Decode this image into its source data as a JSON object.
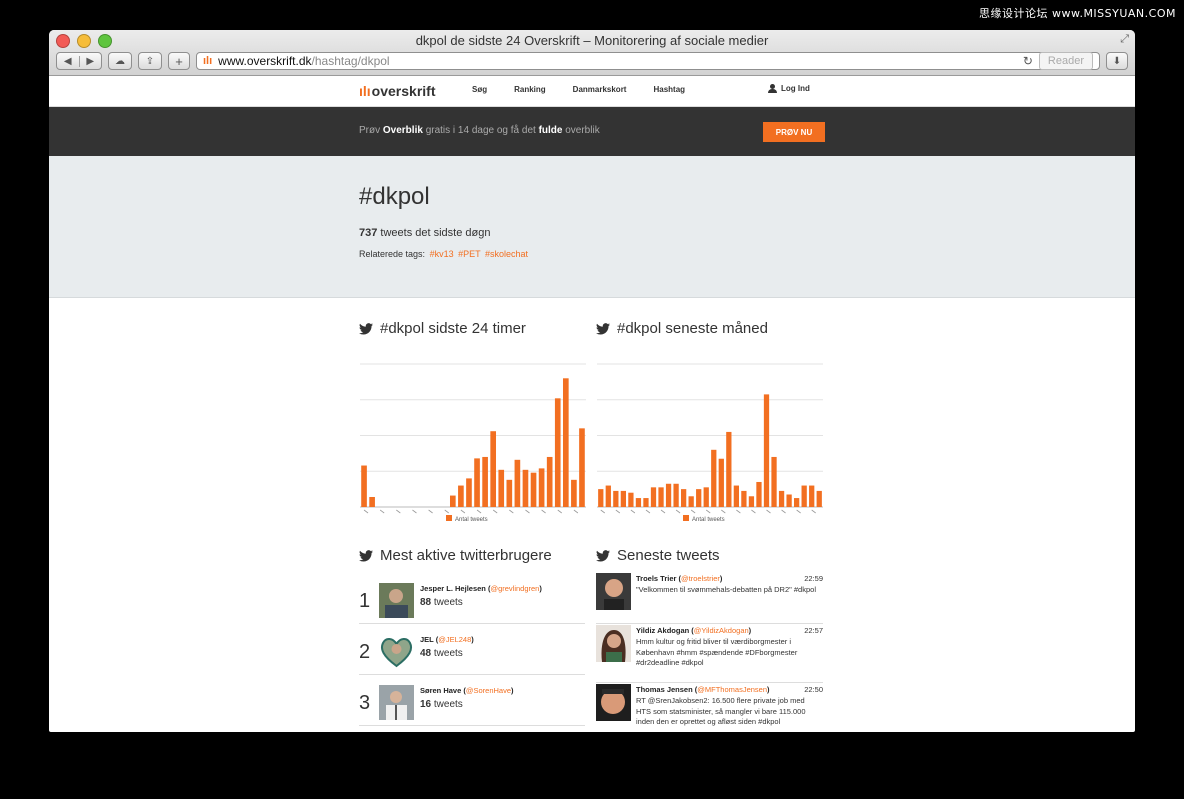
{
  "watermark": "思缘设计论坛 www.MISSYUAN.COM",
  "window": {
    "title": "dkpol de sidste 24 Overskrift – Monitorering af sociale medier"
  },
  "toolbar": {
    "url_host": "www.overskrift.dk",
    "url_path": "/hashtag/dkpol",
    "reader_label": "Reader"
  },
  "site": {
    "logo": "overskrift",
    "nav": [
      "Søg",
      "Ranking",
      "Danmarkskort",
      "Hashtag"
    ],
    "login": "Log Ind"
  },
  "promo": {
    "text_pre": "Prøv ",
    "text_bold1": "Overblik",
    "text_mid": " gratis i 14 dage og få det ",
    "text_bold2": "fulde",
    "text_post": " overblik",
    "button": "PRØV NU"
  },
  "hero": {
    "title": "#dkpol",
    "count": "737",
    "count_suffix": " tweets det sidste døgn",
    "related_label": "Relaterede tags:",
    "related_tags": [
      "#kv13",
      "#PET",
      "#skolechat"
    ]
  },
  "sections": {
    "chart24_title": "#dkpol sidste 24 timer",
    "chart_month_title": "#dkpol seneste måned",
    "users_title": "Mest aktive twitterbrugere",
    "tweets_title": "Seneste tweets"
  },
  "chart_data": [
    {
      "type": "bar",
      "values": [
        29,
        7,
        0,
        0,
        0,
        0,
        0,
        0,
        0,
        0,
        0,
        8,
        15,
        20,
        34,
        35,
        53,
        26,
        19,
        33,
        26,
        24,
        27,
        35,
        76,
        90,
        19,
        55
      ],
      "ylim": [
        0,
        100
      ],
      "legend": "Antal tweets",
      "color": "#f26f21"
    },
    {
      "type": "bar",
      "values": [
        10,
        12,
        9,
        9,
        8,
        5,
        5,
        11,
        11,
        13,
        13,
        10,
        6,
        10,
        11,
        32,
        27,
        42,
        12,
        9,
        6,
        14,
        63,
        28,
        9,
        7,
        5,
        12,
        12,
        9
      ],
      "ylim": [
        0,
        80
      ],
      "legend": "Antal tweets",
      "color": "#f26f21"
    }
  ],
  "users": [
    {
      "rank": "1",
      "name": "Jesper L. Hejlesen",
      "handle": "@grevlindgren",
      "count": "88",
      "count_suffix": " tweets"
    },
    {
      "rank": "2",
      "name": "JEL",
      "handle": "@JEL248",
      "count": "48",
      "count_suffix": " tweets"
    },
    {
      "rank": "3",
      "name": "Søren Have",
      "handle": "@SorenHave",
      "count": "16",
      "count_suffix": " tweets"
    }
  ],
  "tweets": [
    {
      "name": "Troels Trier",
      "handle": "@troelstrier",
      "time": "22:59",
      "text": "\"Velkommen til svømmehals-debatten på DR2\" #dkpol"
    },
    {
      "name": "Yildiz Akdogan",
      "handle": "@YildizAkdogan",
      "time": "22:57",
      "text": "Hmm kultur og fritid bliver til værdiborgmester i København #hmm #spændende #DFborgmester #dr2deadline #dkpol"
    },
    {
      "name": "Thomas Jensen",
      "handle": "@MFThomasJensen",
      "time": "22:50",
      "text": "RT @SrenJakobsen2: 16.500 flere private job med HTS som statsminister, så mangler vi bare 115.000 inden den er oprettet og afløst siden #dkpol"
    }
  ],
  "colors": {
    "accent": "#f26f21",
    "banner": "#333333",
    "hero_bg": "#e8ecee"
  }
}
